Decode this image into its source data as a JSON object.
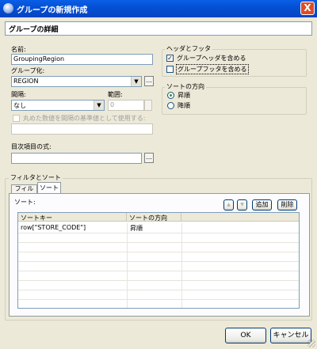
{
  "window": {
    "title": "グループの新規作成",
    "close_label": "X"
  },
  "header": {
    "title": "グループの詳細"
  },
  "name": {
    "label": "名前:",
    "value": "GroupingRegion"
  },
  "group_on": {
    "label": "グループ化:",
    "value": "REGION",
    "ellipsis": "..."
  },
  "interval": {
    "label": "間隔:",
    "value": "なし"
  },
  "range": {
    "label": "範囲:",
    "value": "0"
  },
  "round_base": {
    "label": "丸めた数値を間隔の基準値として使用する:",
    "checked": false,
    "value": ""
  },
  "toc": {
    "label": "目次項目の式:",
    "value": "",
    "ellipsis": "..."
  },
  "header_footer": {
    "title": "ヘッダとフッタ",
    "include_header": {
      "label": "グループヘッダを含める",
      "checked": true
    },
    "include_footer": {
      "label": "グループフッタを含める",
      "checked": false
    }
  },
  "sort_direction": {
    "title": "ソートの方向",
    "ascending": {
      "label": "昇順",
      "selected": true
    },
    "descending": {
      "label": "降順",
      "selected": false
    }
  },
  "filter_sort": {
    "title": "フィルタとソート",
    "tabs": [
      {
        "label": "フィルタ",
        "active": false
      },
      {
        "label": "ソート",
        "active": true
      }
    ],
    "sort_label": "ソート:",
    "buttons": {
      "up": "▲",
      "down": "▼",
      "add": "追加",
      "delete": "削除"
    },
    "columns": [
      "ソートキー",
      "ソートの方向"
    ],
    "rows": [
      {
        "key": "row[\"STORE_CODE\"]",
        "direction": "昇順"
      }
    ]
  },
  "footer": {
    "ok": "OK",
    "cancel": "キャンセル"
  },
  "colors": {
    "titlebar": "#0550D4",
    "face": "#ECE9D8",
    "border": "#7F9DB9",
    "close": "#E04B24"
  }
}
